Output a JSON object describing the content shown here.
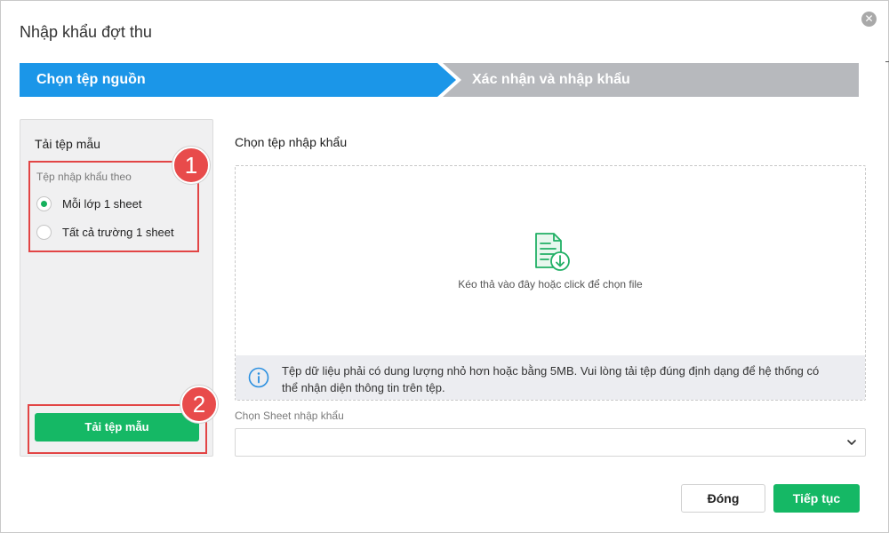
{
  "dialog": {
    "title": "Nhập khẩu đợt thu",
    "close_icon": "close-icon"
  },
  "steps": [
    {
      "label": "Chọn tệp nguồn",
      "active": true
    },
    {
      "label": "Xác nhận và nhập khẩu",
      "active": false
    }
  ],
  "left_panel": {
    "title": "Tải tệp mẫu",
    "options_label": "Tệp nhập khẩu theo",
    "options": [
      {
        "label": "Mỗi lớp 1 sheet",
        "selected": true
      },
      {
        "label": "Tất cả trường 1 sheet",
        "selected": false
      }
    ],
    "download_button": "Tải tệp mẫu"
  },
  "annotations": {
    "badge_1": "1",
    "badge_2": "2"
  },
  "upload": {
    "title": "Chọn tệp nhập khẩu",
    "drop_text": "Kéo thả vào đây hoặc click để chọn file",
    "info_text": "Tệp dữ liệu phải có dung lượng nhỏ hơn hoặc bằng 5MB. Vui lòng tải tệp đúng định dạng để hệ thống có thể nhận diện thông tin trên tệp.",
    "file_icon": "file-download-icon",
    "info_icon": "info-icon"
  },
  "sheet": {
    "label": "Chọn Sheet nhập khẩu",
    "value": ""
  },
  "footer": {
    "close_label": "Đóng",
    "next_label": "Tiếp tục"
  },
  "colors": {
    "active_step": "#1b96e8",
    "inactive_step": "#b7b9bd",
    "primary_button": "#15b865",
    "annotation_red": "#e84b4b"
  }
}
